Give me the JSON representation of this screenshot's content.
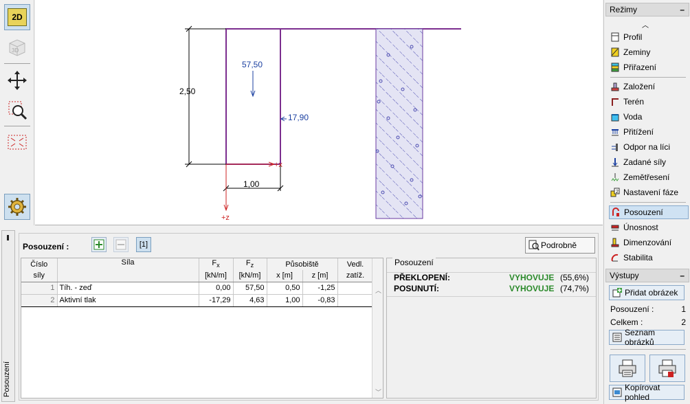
{
  "toolbar": {
    "btn_2d": "2D",
    "btn_3d": "3D"
  },
  "drawing": {
    "dim_height": "2,50",
    "dim_width": "1,00",
    "force_vertical": "57,50",
    "force_horizontal": "17,90",
    "axis_x": "+x",
    "axis_z": "+z"
  },
  "modes": {
    "header": "Režimy",
    "items": [
      {
        "label": "Profil",
        "icon": "profile-icon"
      },
      {
        "label": "Zeminy",
        "icon": "soils-icon"
      },
      {
        "label": "Přiřazení",
        "icon": "assign-icon"
      },
      {
        "label": "Založení",
        "icon": "foundation-icon"
      },
      {
        "label": "Terén",
        "icon": "terrain-icon"
      },
      {
        "label": "Voda",
        "icon": "water-icon"
      },
      {
        "label": "Přitížení",
        "icon": "surcharge-icon"
      },
      {
        "label": "Odpor na líci",
        "icon": "front-resistance-icon"
      },
      {
        "label": "Zadané síly",
        "icon": "applied-forces-icon"
      },
      {
        "label": "Zemětřesení",
        "icon": "earthquake-icon"
      },
      {
        "label": "Nastavení fáze",
        "icon": "stage-settings-icon"
      },
      {
        "label": "Posouzení",
        "icon": "verification-icon"
      },
      {
        "label": "Únosnost",
        "icon": "bearing-capacity-icon"
      },
      {
        "label": "Dimenzování",
        "icon": "dimensioning-icon"
      },
      {
        "label": "Stabilita",
        "icon": "stability-icon"
      }
    ]
  },
  "outputs": {
    "header": "Výstupy",
    "add_image": "Přidat obrázek",
    "verification_label": "Posouzení :",
    "verification_count": "1",
    "total_label": "Celkem :",
    "total_count": "2",
    "image_list": "Seznam obrázků",
    "copy_view": "Kopírovat pohled"
  },
  "bottom": {
    "tab_label": "Posouzení",
    "section_label": "Posouzení :",
    "page_indicator": "[1]",
    "detail_button": "Podrobně"
  },
  "table": {
    "headers": {
      "num_top": "Číslo",
      "num_bottom": "síly",
      "force": "Síla",
      "fx": "F",
      "fx_sub": "x",
      "fz": "F",
      "fz_sub": "z",
      "point": "Působiště",
      "secondary_top": "Vedl.",
      "secondary_bottom": "zatíž.",
      "unit_fx": "[kN/m]",
      "unit_fz": "[kN/m]",
      "unit_x": "x [m]",
      "unit_z": "z [m]"
    },
    "rows": [
      {
        "idx": "1",
        "name": "Tíh. - zeď",
        "fx": "0,00",
        "fz": "57,50",
        "x": "0,50",
        "z": "-1,25",
        "sec": ""
      },
      {
        "idx": "2",
        "name": "Aktivní tlak",
        "fx": "-17,29",
        "fz": "4,63",
        "x": "1,00",
        "z": "-0,83",
        "sec": ""
      }
    ]
  },
  "results": {
    "title": "Posouzení",
    "rows": [
      {
        "name": "PŘEKLOPENÍ:",
        "status": "VYHOVUJE",
        "pct": "(55,6%)"
      },
      {
        "name": "POSUNUTÍ:",
        "status": "VYHOVUJE",
        "pct": "(74,7%)"
      }
    ],
    "status_color": "#2b8a2b"
  },
  "colors": {
    "wall": "#7b2d8e",
    "dimension": "#000000",
    "force_label": "#1a3fa0",
    "axis": "#cc2222",
    "hatch": "#4a4ab0"
  }
}
